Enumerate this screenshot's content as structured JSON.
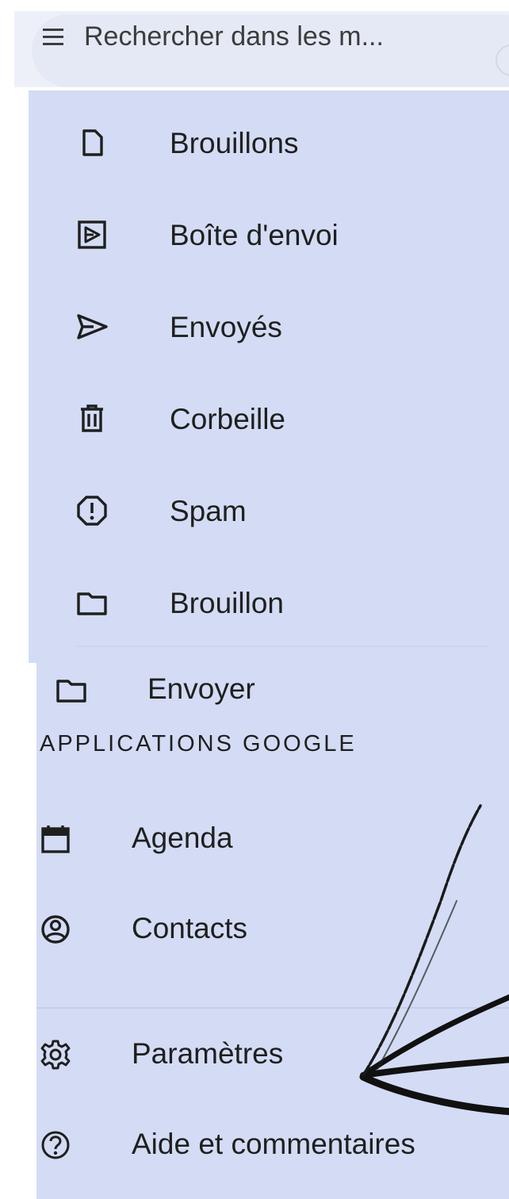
{
  "search": {
    "placeholder": "Rechercher dans les m..."
  },
  "drawer": {
    "folders": [
      {
        "label": "Brouillons",
        "icon": "draft-icon"
      },
      {
        "label": "Boîte d'envoi",
        "icon": "outbox-icon"
      },
      {
        "label": "Envoyés",
        "icon": "send-icon"
      },
      {
        "label": "Corbeille",
        "icon": "trash-icon"
      },
      {
        "label": "Spam",
        "icon": "spam-icon"
      },
      {
        "label": "Brouillon",
        "icon": "folder-icon"
      }
    ],
    "custom_label": {
      "label": "Envoyer",
      "icon": "folder-icon"
    },
    "apps_header": "APPLICATIONS GOOGLE",
    "apps": [
      {
        "label": "Agenda",
        "icon": "calendar-icon"
      },
      {
        "label": "Contacts",
        "icon": "contacts-icon"
      }
    ],
    "footer": [
      {
        "label": "Paramètres",
        "icon": "gear-icon"
      },
      {
        "label": "Aide et commentaires",
        "icon": "help-icon"
      }
    ]
  },
  "colors": {
    "drawer_background": "#d3dcf4",
    "search_background": "#e4e9f5",
    "text": "#1f1f1f"
  }
}
